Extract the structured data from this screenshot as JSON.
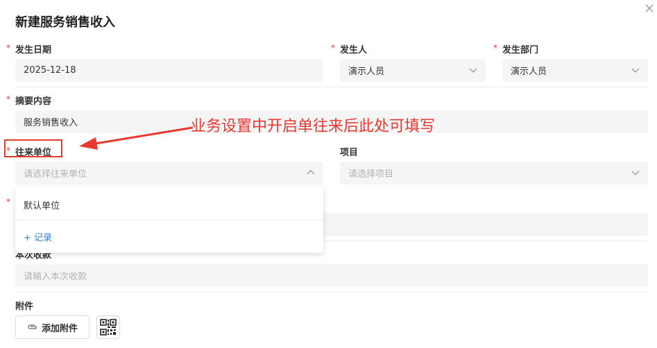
{
  "dialog": {
    "title": "新建服务销售收入"
  },
  "fields": {
    "date": {
      "label": "发生日期",
      "value": "2025-12-18"
    },
    "person": {
      "label": "发生人",
      "value": "演示人员"
    },
    "dept": {
      "label": "发生部门",
      "value": "演示人员"
    },
    "summary": {
      "label": "摘要内容",
      "value": "服务销售收入"
    },
    "counterparty": {
      "label": "往来单位",
      "placeholder": "请选择往来单位"
    },
    "project": {
      "label": "项目",
      "placeholder": "请选择项目"
    },
    "receipt": {
      "label": "本次收款",
      "placeholder": "请输入本次收款"
    },
    "attachment": {
      "label": "附件",
      "button_label": "添加附件"
    }
  },
  "dropdown": {
    "items": [
      "默认单位"
    ],
    "add_label": "+ 记录"
  },
  "annotation": {
    "text": "业务设置中开启单往来后此处可填写"
  },
  "colors": {
    "required": "#e8382f",
    "link": "#2f80d1",
    "annotation": "#e8382f"
  }
}
